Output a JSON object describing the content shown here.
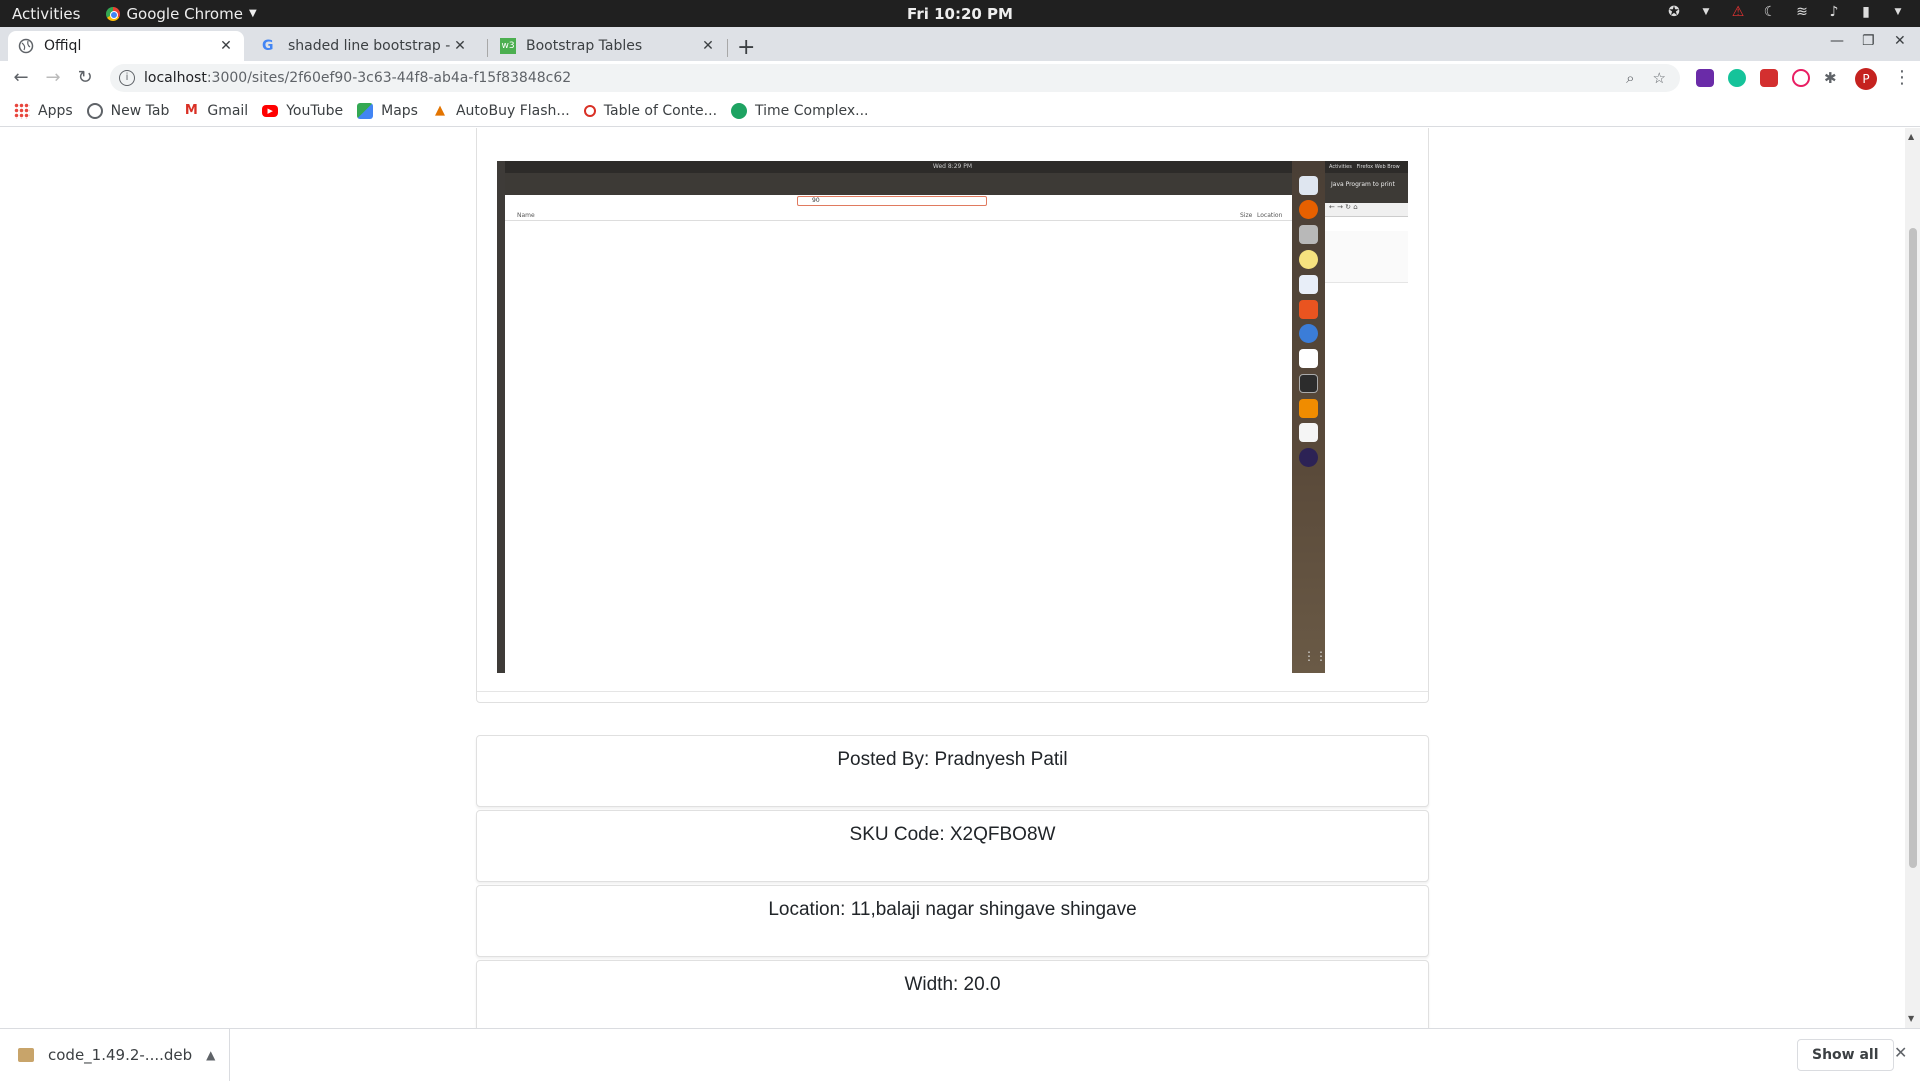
{
  "system": {
    "activities": "Activities",
    "app_name": "Google Chrome",
    "clock": "Fri 10:20 PM"
  },
  "tabs": [
    {
      "title": "Offiql",
      "favicon": "globe-icon",
      "active": true
    },
    {
      "title": "shaded line bootstrap - Go",
      "favicon": "google-icon",
      "active": false
    },
    {
      "title": "Bootstrap Tables",
      "favicon": "w3-icon",
      "active": false
    }
  ],
  "toolbar": {
    "url_host": "localhost",
    "url_path": ":3000/sites/2f60ef90-3c63-44f8-ab4a-f15f83848c62",
    "profile_initial": "P"
  },
  "bookmarks": [
    {
      "label": "Apps",
      "icon": "apps-grid-icon",
      "color": "#e8453c"
    },
    {
      "label": "New Tab",
      "icon": "globe-icon",
      "color": "#5f6368"
    },
    {
      "label": "Gmail",
      "icon": "gmail-icon",
      "color": "#d93025"
    },
    {
      "label": "YouTube",
      "icon": "youtube-icon",
      "color": "#ff0000"
    },
    {
      "label": "Maps",
      "icon": "maps-icon",
      "color": "#34a853"
    },
    {
      "label": "AutoBuy Flash...",
      "icon": "autobuy-icon",
      "color": "#e37400"
    },
    {
      "label": "Table of Conte...",
      "icon": "opera-icon",
      "color": "#d93025"
    },
    {
      "label": "Time Complex...",
      "icon": "time-complex-icon",
      "color": "#1ea362"
    }
  ],
  "embedded_screenshot": {
    "top_clock": "Wed 8:29 PM",
    "search_text": "90",
    "col_name": "Name",
    "col_size": "Size",
    "col_location": "Location",
    "right_activities": "Activities",
    "right_app": "Firefox Web Brow",
    "right_tab": "Java Program to print"
  },
  "details": {
    "posted_by": "Posted By: Pradnyesh Patil",
    "sku": "SKU Code: X2QFBO8W",
    "location": "Location: 11,balaji nagar shingave shingave",
    "width": "Width: 20.0"
  },
  "downloads": {
    "file": "code_1.49.2-....deb",
    "show_all": "Show all"
  }
}
